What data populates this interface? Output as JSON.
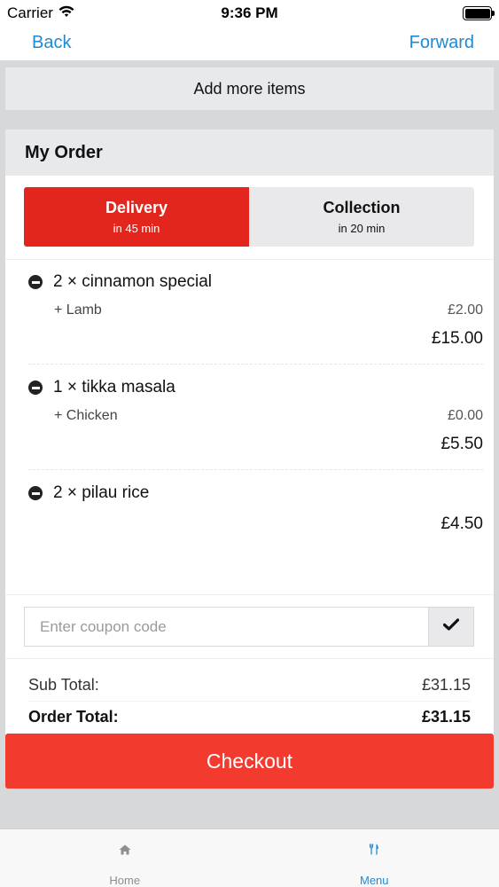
{
  "status_bar": {
    "carrier": "Carrier",
    "time": "9:36 PM",
    "wifi_icon": "wifi-icon",
    "battery_icon": "battery-icon"
  },
  "nav": {
    "back_label": "Back",
    "forward_label": "Forward",
    "link_color": "#1d8ad6"
  },
  "add_more_label": "Add more items",
  "order": {
    "title": "My Order",
    "modes": [
      {
        "title": "Delivery",
        "subtitle": "in 45 min",
        "active": true
      },
      {
        "title": "Collection",
        "subtitle": "in 20 min",
        "active": false
      }
    ],
    "items": [
      {
        "name": "2 × cinnamon special",
        "option": "+ Lamb",
        "option_price": "£2.00",
        "total": "£15.00"
      },
      {
        "name": "1 × tikka masala",
        "option": "+ Chicken",
        "option_price": "£0.00",
        "total": "£5.50"
      },
      {
        "name": "2 × pilau rice",
        "total": "£4.50"
      }
    ],
    "coupon": {
      "placeholder": "Enter coupon code",
      "value": "",
      "apply_icon": "checkmark-icon"
    },
    "sub_total_label": "Sub Total:",
    "sub_total_value": "£31.15",
    "order_total_label": "Order Total:",
    "order_total_value": "£31.15"
  },
  "checkout_label": "Checkout",
  "colors": {
    "accent_red": "#e3261d",
    "checkout_red": "#f33a2f",
    "tab_active": "#1d8ad6",
    "tab_inactive": "#8e8e93"
  },
  "tabs": [
    {
      "label": "Home",
      "icon": "home-icon",
      "active": false
    },
    {
      "label": "Menu",
      "icon": "fork-knife-icon",
      "active": true
    }
  ]
}
